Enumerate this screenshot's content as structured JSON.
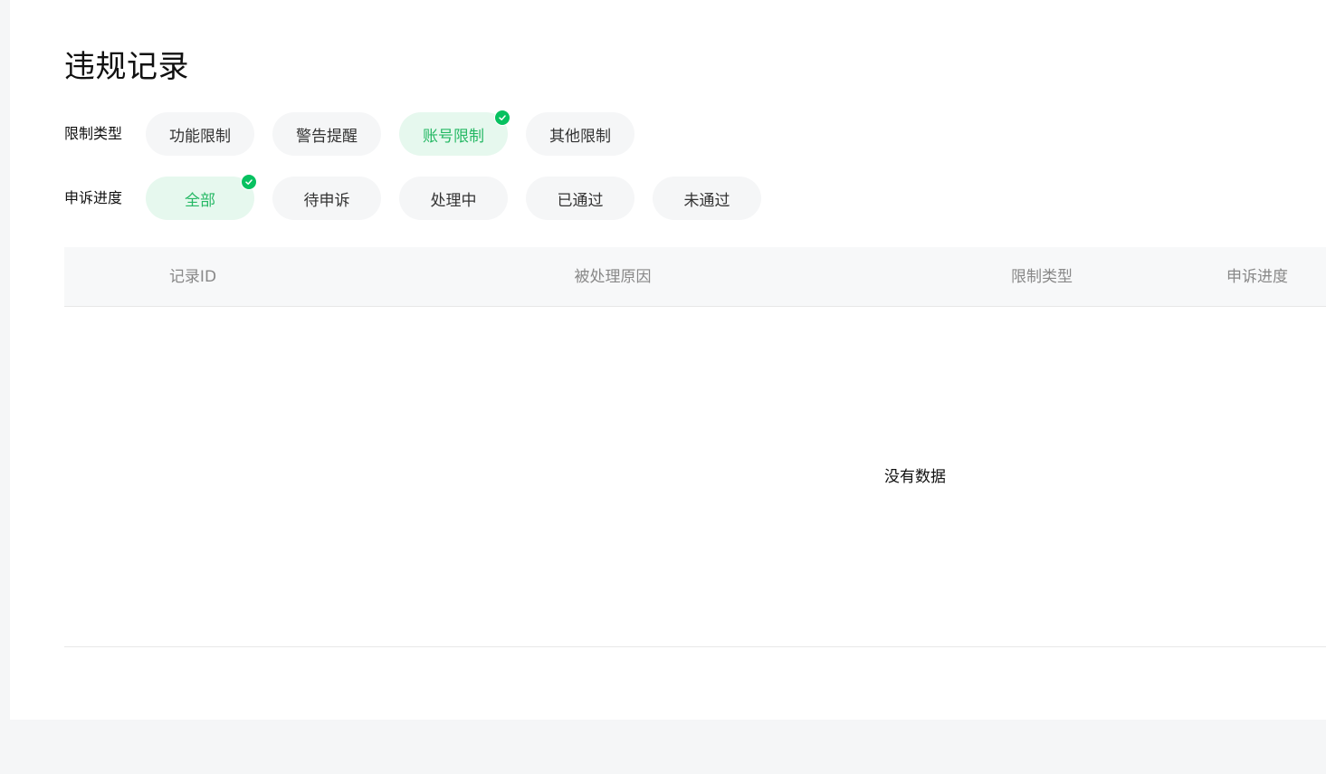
{
  "page": {
    "title": "违规记录"
  },
  "filters": {
    "restriction_type": {
      "label": "限制类型",
      "options": [
        {
          "label": "功能限制",
          "active": false
        },
        {
          "label": "警告提醒",
          "active": false
        },
        {
          "label": "账号限制",
          "active": true
        },
        {
          "label": "其他限制",
          "active": false
        }
      ]
    },
    "appeal_progress": {
      "label": "申诉进度",
      "options": [
        {
          "label": "全部",
          "active": true
        },
        {
          "label": "待申诉",
          "active": false
        },
        {
          "label": "处理中",
          "active": false
        },
        {
          "label": "已通过",
          "active": false
        },
        {
          "label": "未通过",
          "active": false
        }
      ]
    }
  },
  "table": {
    "columns": [
      "记录ID",
      "被处理原因",
      "限制类型",
      "申诉进度"
    ],
    "empty_text": "没有数据"
  },
  "colors": {
    "accent": "#25b864",
    "check_badge": "#07c160",
    "active_chip_bg": "#e6f8ee",
    "chip_bg": "#f5f6f7",
    "header_bg": "#f7f8f9"
  },
  "icons": {
    "selected_badge": "check-circle-icon"
  }
}
